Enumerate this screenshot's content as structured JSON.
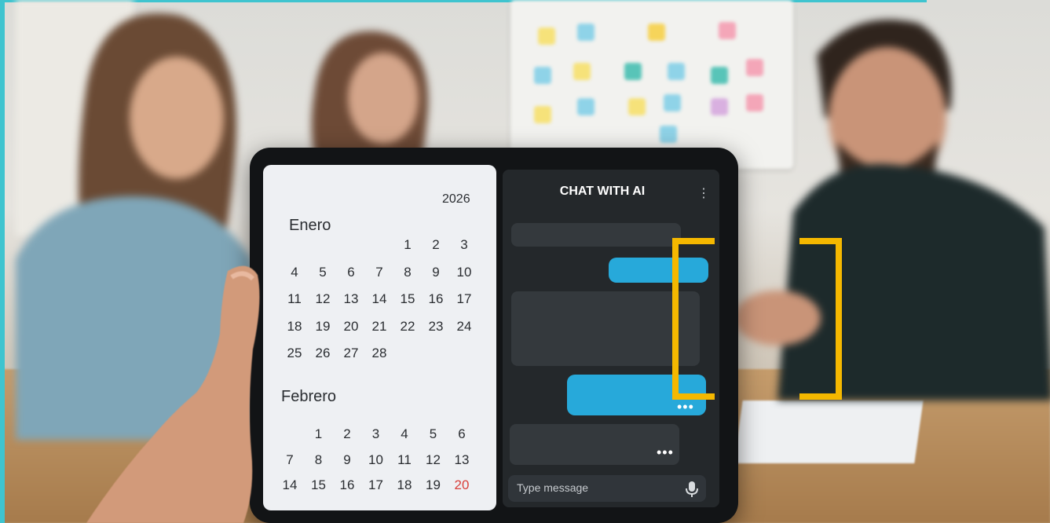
{
  "calendar": {
    "year": "2026",
    "month1": "Enero",
    "month2": "Febrero",
    "jan": [
      [
        "",
        "",
        "",
        "",
        "1",
        "2",
        "3"
      ],
      [
        "4",
        "5",
        "6",
        "7",
        "8",
        "9",
        "10"
      ],
      [
        "11",
        "12",
        "13",
        "14",
        "15",
        "16",
        "17"
      ],
      [
        "18",
        "19",
        "20",
        "21",
        "22",
        "23",
        "24"
      ],
      [
        "25",
        "26",
        "27",
        "28",
        "",
        "",
        ""
      ]
    ],
    "feb": [
      [
        "",
        "1",
        "2",
        "3",
        "4",
        "5",
        "6"
      ],
      [
        "7",
        "8",
        "9",
        "10",
        "11",
        "12",
        "13"
      ],
      [
        "14",
        "15",
        "16",
        "17",
        "18",
        "19",
        "20"
      ]
    ],
    "highlight_day": "20",
    "highlight_color": "#d9403b"
  },
  "chat": {
    "title": "CHAT WITH AI",
    "menu_icon": "kebab-icon",
    "typing_indicator": "•••",
    "input_placeholder": "Type message",
    "mic_icon": "microphone-icon",
    "user_bubble_color": "#27a9da"
  },
  "overlay": {
    "bracket_color": "#f5b800"
  }
}
